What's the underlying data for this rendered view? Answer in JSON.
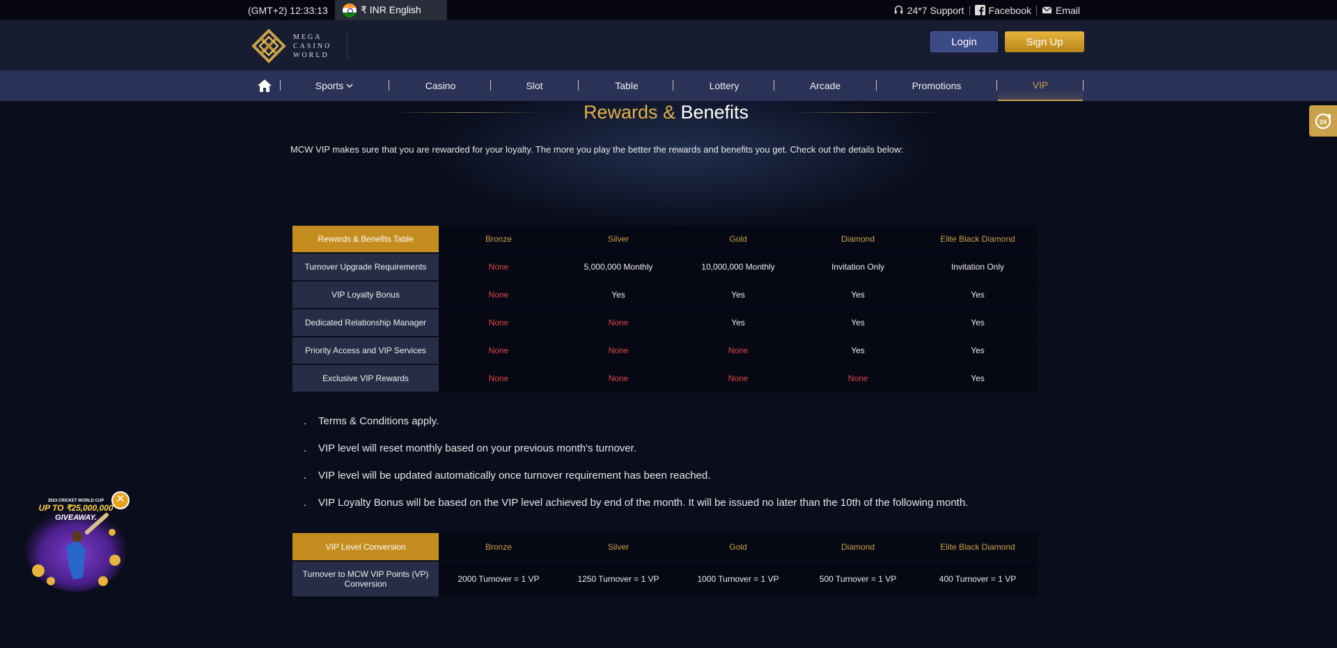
{
  "topbar": {
    "time": "(GMT+2) 12:33:13",
    "currency_lang": "₹ INR English",
    "support": "24*7 Support",
    "facebook": "Facebook",
    "email": "Email"
  },
  "header": {
    "logo_line1": "MEGA",
    "logo_line2": "CASINO",
    "logo_line3": "WORLD",
    "login_label": "Login",
    "signup_label": "Sign Up"
  },
  "nav": {
    "items": [
      {
        "label": "Sports"
      },
      {
        "label": "Casino"
      },
      {
        "label": "Slot"
      },
      {
        "label": "Table"
      },
      {
        "label": "Lottery"
      },
      {
        "label": "Arcade"
      },
      {
        "label": "Promotions"
      },
      {
        "label": "VIP"
      }
    ]
  },
  "main": {
    "title_gold": "Rewards &",
    "title_white": " Benefits",
    "intro": "MCW VIP makes sure that you are rewarded for your loyalty. The more you play the better the rewards and benefits you get. Check out the details below:"
  },
  "rewards_table": {
    "header": [
      "Rewards & Benefits Table",
      "Bronze",
      "Silver",
      "Gold",
      "Diamond",
      "Elite Black Diamond"
    ],
    "rows": [
      [
        "Turnover Upgrade Requirements",
        "None",
        "5,000,000 Monthly",
        "10,000,000 Monthly",
        "Invitation Only",
        "Invitation Only"
      ],
      [
        "VIP Loyalty Bonus",
        "None",
        "Yes",
        "Yes",
        "Yes",
        "Yes"
      ],
      [
        "Dedicated Relationship Manager",
        "None",
        "None",
        "Yes",
        "Yes",
        "Yes"
      ],
      [
        "Priority Access and VIP Services",
        "None",
        "None",
        "None",
        "Yes",
        "Yes"
      ],
      [
        "Exclusive VIP Rewards",
        "None",
        "None",
        "None",
        "None",
        "Yes"
      ]
    ]
  },
  "notes": [
    "Terms & Conditions apply.",
    "VIP level will reset monthly based on your previous month's turnover.",
    "VIP level will be updated automatically once turnover requirement has been reached.",
    "VIP Loyalty Bonus will be based on the VIP level achieved by end of the month. It will be issued no later than the 10th of the following month."
  ],
  "conversion_table": {
    "header": [
      "VIP Level Conversion",
      "Bronze",
      "Silver",
      "Gold",
      "Diamond",
      "Elite Black Diamond"
    ],
    "row": [
      "Turnover to MCW VIP Points (VP) Conversion",
      "2000 Turnover = 1 VP",
      "1250 Turnover = 1 VP",
      "1000 Turnover = 1 VP",
      "500 Turnover = 1 VP",
      "400 Turnover = 1 VP"
    ]
  },
  "promo": {
    "line1": "2023 CRICKET WORLD CUP",
    "line2": "UP TO ₹25,000,000",
    "line3": "GIVEAWAY."
  },
  "colors": {
    "gold": "#c9a24b",
    "none_red": "#e04848",
    "nav_bg": "#2b3257"
  }
}
